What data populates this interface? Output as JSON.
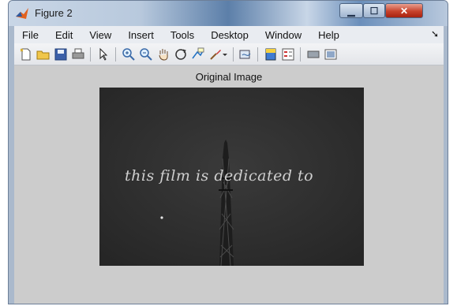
{
  "window": {
    "title": "Figure 2"
  },
  "menu": [
    "File",
    "Edit",
    "View",
    "Insert",
    "Tools",
    "Desktop",
    "Window",
    "Help"
  ],
  "toolbar_icons": [
    "new-figure-icon",
    "open-file-icon",
    "save-icon",
    "print-icon",
    "edit-plot-arrow-icon",
    "zoom-in-icon",
    "zoom-out-icon",
    "pan-hand-icon",
    "rotate-3d-icon",
    "data-cursor-icon",
    "brush-icon",
    "brush-dropdown-icon",
    "link-plot-icon",
    "insert-colorbar-icon",
    "insert-legend-icon",
    "hide-plot-tools-icon",
    "show-plot-tools-icon"
  ],
  "axes": {
    "title": "Original  Image"
  },
  "image": {
    "caption": "this film is dedicated to"
  },
  "colors": {
    "figure_bg": "#cccccc",
    "image_bg": "#2e2e2e",
    "close_red": "#c7422b"
  }
}
